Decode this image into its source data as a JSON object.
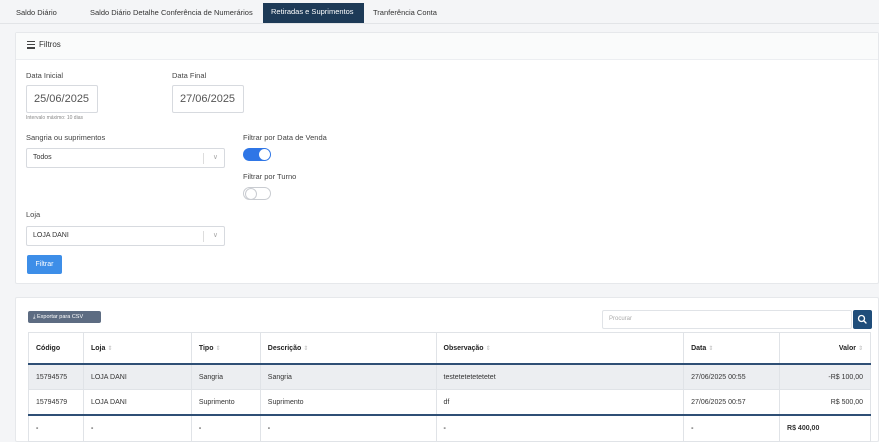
{
  "tabs": [
    {
      "label": "Saldo Diário"
    },
    {
      "label": "Saldo Diário Detalhe"
    },
    {
      "label": "Conferência de Numerários"
    },
    {
      "label": "Retiradas e Suprimentos",
      "active": true
    },
    {
      "label": "Tranferência Conta"
    }
  ],
  "filters": {
    "title": "Filtros",
    "start_date_label": "Data Inicial",
    "start_date_value": "25/06/2025",
    "end_date_label": "Data Final",
    "end_date_value": "27/06/2025",
    "interval_hint": "Intervalo máximo: 10 dias",
    "type_label": "Sangria ou suprimentos",
    "type_value": "Todos",
    "sale_date_label": "Filtrar por Data de Venda",
    "sale_date_enabled": true,
    "shift_label": "Filtrar por Turno",
    "shift_enabled": false,
    "store_label": "Loja",
    "store_value": "LOJA DANI",
    "filter_button": "Filtrar"
  },
  "table_toolbar": {
    "export_label": "Exportar para CSV",
    "search_placeholder": "Procurar"
  },
  "table": {
    "headers": [
      "Código",
      "Loja",
      "Tipo",
      "Descrição",
      "Observação",
      "Data",
      "Valor"
    ],
    "rows": [
      {
        "codigo": "15794575",
        "loja": "LOJA DANI",
        "tipo": "Sangria",
        "descricao": "Sangria",
        "observacao": "testetetetetetetet",
        "data": "27/06/2025 00:55",
        "valor": "-R$ 100,00"
      },
      {
        "codigo": "15794579",
        "loja": "LOJA DANI",
        "tipo": "Suprimento",
        "descricao": "Suprimento",
        "observacao": "df",
        "data": "27/06/2025 00:57",
        "valor": "R$ 500,00"
      }
    ],
    "total": {
      "codigo": "-",
      "loja": "-",
      "tipo": "-",
      "descricao": "-",
      "observacao": "-",
      "data": "-",
      "valor": "R$ 400,00"
    }
  },
  "colors": {
    "accent": "#1d3a57",
    "primary_button": "#3d8ee8",
    "toggle_on": "#2f76e6"
  }
}
